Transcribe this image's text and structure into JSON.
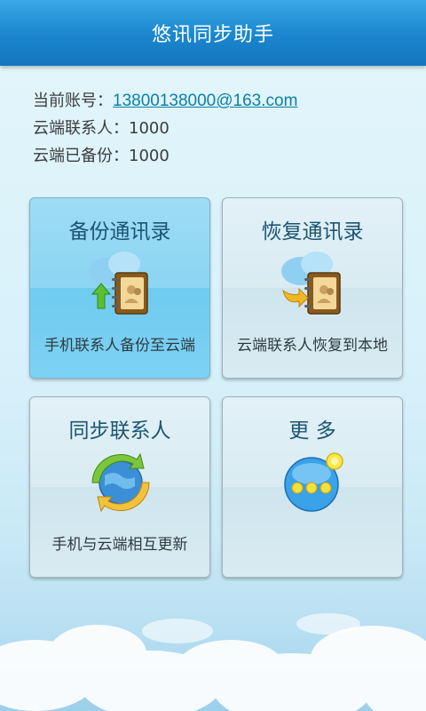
{
  "header": {
    "title": "悠讯同步助手"
  },
  "account": {
    "label": "当前账号：",
    "email": "13800138000@163.com",
    "contacts_label": "云端联系人：",
    "contacts_value": "1000",
    "backup_label": "云端已备份：",
    "backup_value": "1000"
  },
  "cards": [
    {
      "title": "备份通讯录",
      "subtitle": "手机联系人备份至云端",
      "icon": "cloud-backup-icon"
    },
    {
      "title": "恢复通讯录",
      "subtitle": "云端联系人恢复到本地",
      "icon": "cloud-restore-icon"
    },
    {
      "title": "同步联系人",
      "subtitle": "手机与云端相互更新",
      "icon": "sync-globe-icon"
    },
    {
      "title": "更 多",
      "subtitle": "",
      "icon": "more-dots-icon"
    }
  ],
  "colors": {
    "header": "#1a86cf",
    "link": "#0c7fa8",
    "active_card": "#7cd2f4"
  }
}
